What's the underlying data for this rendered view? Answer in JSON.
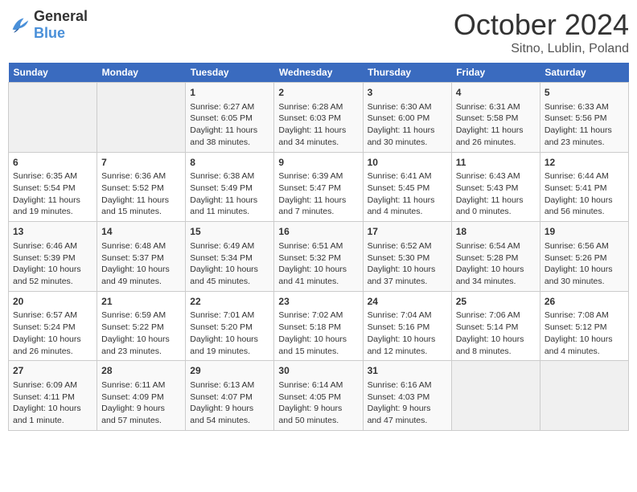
{
  "header": {
    "logo_line1": "General",
    "logo_line2": "Blue",
    "month": "October 2024",
    "location": "Sitno, Lublin, Poland"
  },
  "weekdays": [
    "Sunday",
    "Monday",
    "Tuesday",
    "Wednesday",
    "Thursday",
    "Friday",
    "Saturday"
  ],
  "weeks": [
    [
      {
        "day": "",
        "info": ""
      },
      {
        "day": "",
        "info": ""
      },
      {
        "day": "1",
        "info": "Sunrise: 6:27 AM\nSunset: 6:05 PM\nDaylight: 11 hours\nand 38 minutes."
      },
      {
        "day": "2",
        "info": "Sunrise: 6:28 AM\nSunset: 6:03 PM\nDaylight: 11 hours\nand 34 minutes."
      },
      {
        "day": "3",
        "info": "Sunrise: 6:30 AM\nSunset: 6:00 PM\nDaylight: 11 hours\nand 30 minutes."
      },
      {
        "day": "4",
        "info": "Sunrise: 6:31 AM\nSunset: 5:58 PM\nDaylight: 11 hours\nand 26 minutes."
      },
      {
        "day": "5",
        "info": "Sunrise: 6:33 AM\nSunset: 5:56 PM\nDaylight: 11 hours\nand 23 minutes."
      }
    ],
    [
      {
        "day": "6",
        "info": "Sunrise: 6:35 AM\nSunset: 5:54 PM\nDaylight: 11 hours\nand 19 minutes."
      },
      {
        "day": "7",
        "info": "Sunrise: 6:36 AM\nSunset: 5:52 PM\nDaylight: 11 hours\nand 15 minutes."
      },
      {
        "day": "8",
        "info": "Sunrise: 6:38 AM\nSunset: 5:49 PM\nDaylight: 11 hours\nand 11 minutes."
      },
      {
        "day": "9",
        "info": "Sunrise: 6:39 AM\nSunset: 5:47 PM\nDaylight: 11 hours\nand 7 minutes."
      },
      {
        "day": "10",
        "info": "Sunrise: 6:41 AM\nSunset: 5:45 PM\nDaylight: 11 hours\nand 4 minutes."
      },
      {
        "day": "11",
        "info": "Sunrise: 6:43 AM\nSunset: 5:43 PM\nDaylight: 11 hours\nand 0 minutes."
      },
      {
        "day": "12",
        "info": "Sunrise: 6:44 AM\nSunset: 5:41 PM\nDaylight: 10 hours\nand 56 minutes."
      }
    ],
    [
      {
        "day": "13",
        "info": "Sunrise: 6:46 AM\nSunset: 5:39 PM\nDaylight: 10 hours\nand 52 minutes."
      },
      {
        "day": "14",
        "info": "Sunrise: 6:48 AM\nSunset: 5:37 PM\nDaylight: 10 hours\nand 49 minutes."
      },
      {
        "day": "15",
        "info": "Sunrise: 6:49 AM\nSunset: 5:34 PM\nDaylight: 10 hours\nand 45 minutes."
      },
      {
        "day": "16",
        "info": "Sunrise: 6:51 AM\nSunset: 5:32 PM\nDaylight: 10 hours\nand 41 minutes."
      },
      {
        "day": "17",
        "info": "Sunrise: 6:52 AM\nSunset: 5:30 PM\nDaylight: 10 hours\nand 37 minutes."
      },
      {
        "day": "18",
        "info": "Sunrise: 6:54 AM\nSunset: 5:28 PM\nDaylight: 10 hours\nand 34 minutes."
      },
      {
        "day": "19",
        "info": "Sunrise: 6:56 AM\nSunset: 5:26 PM\nDaylight: 10 hours\nand 30 minutes."
      }
    ],
    [
      {
        "day": "20",
        "info": "Sunrise: 6:57 AM\nSunset: 5:24 PM\nDaylight: 10 hours\nand 26 minutes."
      },
      {
        "day": "21",
        "info": "Sunrise: 6:59 AM\nSunset: 5:22 PM\nDaylight: 10 hours\nand 23 minutes."
      },
      {
        "day": "22",
        "info": "Sunrise: 7:01 AM\nSunset: 5:20 PM\nDaylight: 10 hours\nand 19 minutes."
      },
      {
        "day": "23",
        "info": "Sunrise: 7:02 AM\nSunset: 5:18 PM\nDaylight: 10 hours\nand 15 minutes."
      },
      {
        "day": "24",
        "info": "Sunrise: 7:04 AM\nSunset: 5:16 PM\nDaylight: 10 hours\nand 12 minutes."
      },
      {
        "day": "25",
        "info": "Sunrise: 7:06 AM\nSunset: 5:14 PM\nDaylight: 10 hours\nand 8 minutes."
      },
      {
        "day": "26",
        "info": "Sunrise: 7:08 AM\nSunset: 5:12 PM\nDaylight: 10 hours\nand 4 minutes."
      }
    ],
    [
      {
        "day": "27",
        "info": "Sunrise: 6:09 AM\nSunset: 4:11 PM\nDaylight: 10 hours\nand 1 minute."
      },
      {
        "day": "28",
        "info": "Sunrise: 6:11 AM\nSunset: 4:09 PM\nDaylight: 9 hours\nand 57 minutes."
      },
      {
        "day": "29",
        "info": "Sunrise: 6:13 AM\nSunset: 4:07 PM\nDaylight: 9 hours\nand 54 minutes."
      },
      {
        "day": "30",
        "info": "Sunrise: 6:14 AM\nSunset: 4:05 PM\nDaylight: 9 hours\nand 50 minutes."
      },
      {
        "day": "31",
        "info": "Sunrise: 6:16 AM\nSunset: 4:03 PM\nDaylight: 9 hours\nand 47 minutes."
      },
      {
        "day": "",
        "info": ""
      },
      {
        "day": "",
        "info": ""
      }
    ]
  ]
}
